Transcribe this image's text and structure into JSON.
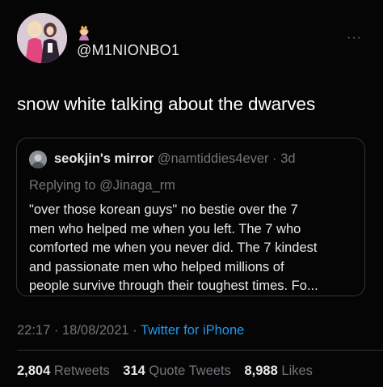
{
  "tweet": {
    "handle": "@M1NIONBO1",
    "text": "snow white talking about the dwarves",
    "more_label": "···"
  },
  "quote": {
    "name": "seokjin's mirror",
    "handle": "@namtiddies4ever",
    "separator": " · ",
    "time": "3d",
    "replying_prefix": "Replying to ",
    "replying_to": "@Jinaga_rm",
    "body_lines": [
      "\"over those korean guys\" no bestie over the 7",
      "men who helped me when you left. The 7 who",
      "comforted me when you never did. The 7 kindest",
      "and passionate men who helped millions of",
      "people survive through their toughest times. Fo..."
    ]
  },
  "meta": {
    "time": "22:17",
    "separator1": " · ",
    "date": "18/08/2021",
    "separator2": " · ",
    "source": "Twitter for iPhone"
  },
  "stats": {
    "retweets_count": "2,804",
    "retweets_label": "Retweets",
    "quotes_count": "314",
    "quotes_label": "Quote Tweets",
    "likes_count": "8,988",
    "likes_label": "Likes"
  },
  "colors": {
    "background": "#050505",
    "primary_text": "#e7e9ea",
    "secondary_text": "#71767b",
    "link": "#1d9bf0",
    "border": "#2f3336"
  },
  "icons": {
    "header_emoji": "princess-emoji-icon",
    "more": "more-horizontal-icon"
  }
}
